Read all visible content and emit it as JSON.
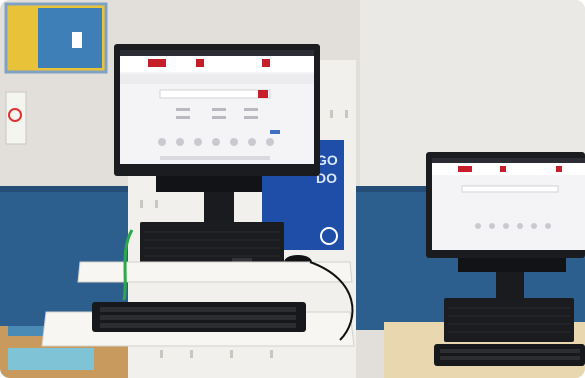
{
  "photo": {
    "scene": "computer-workstations-photo",
    "sign_text_lines": [
      "GO",
      "DO"
    ],
    "colors": {
      "wall": "#e4e1dc",
      "wall_stripe": "#2d5f8e",
      "desk": "#efeeea",
      "screen_bg": "#f4f4f6",
      "screen_header": "#c61f2b",
      "sign_blue": "#1e4ea8"
    }
  }
}
